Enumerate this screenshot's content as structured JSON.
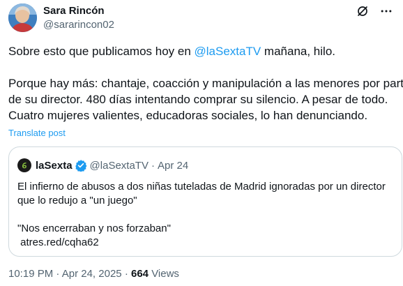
{
  "author": {
    "name": "Sara Rincón",
    "handle": "@sararincon02"
  },
  "tweet": {
    "line1_pre": "Sobre esto que publicamos hoy en ",
    "line1_mention": "@laSextaTV",
    "line1_post": " mañana, hilo.",
    "para2_line1": "Porque hay más: chantaje, coacción y manipulación a las menores por parte",
    "para2_line2": "de su director. 480 días intentando comprar su silencio. A pesar de todo.",
    "para2_line3": "Cuatro mujeres valientes, educadoras sociales, lo han denunciando.",
    "translate_label": "Translate post"
  },
  "quote": {
    "name": "laSexta",
    "handle": "@laSextaTV",
    "separator": "·",
    "date": "Apr 24",
    "text_line1": "El infierno de abusos a dos niñas tuteladas de Madrid ignoradas por un director",
    "text_line2": "que lo redujo a \"un juego\"",
    "text_line3": "\"Nos encerraban y nos forzaban\"",
    "link": "atres.red/cqha62"
  },
  "footer": {
    "time": "10:19 PM",
    "separator": "·",
    "date": "Apr 24, 2025",
    "views_count": "664",
    "views_label": "Views"
  },
  "icons": {
    "grok": "grok-icon",
    "more": "more-icon",
    "verified": "verified-badge-icon",
    "logo": "lasexta-logo-icon"
  },
  "colors": {
    "link": "#1d9bf0",
    "secondary_text": "#536471",
    "primary_text": "#0f1419",
    "border": "#cfd9de",
    "lasexta_green": "#8cc63f"
  }
}
